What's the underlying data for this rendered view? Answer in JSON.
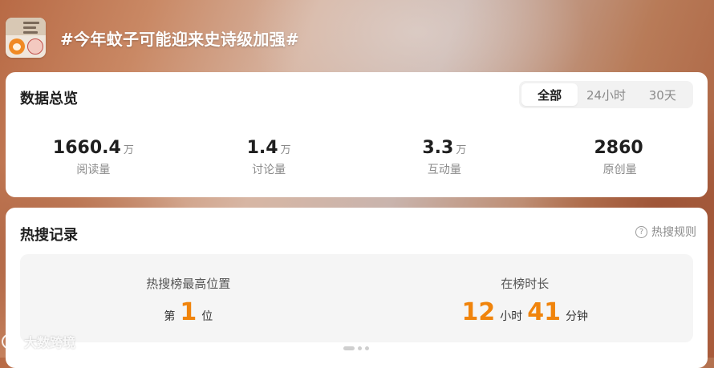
{
  "topic": {
    "title": "#今年蚊子可能迎来史诗级加强#",
    "thumbnail_icon": "topic-thumbnail-image"
  },
  "overview": {
    "title": "数据总览",
    "tabs": [
      {
        "label": "全部",
        "active": true
      },
      {
        "label": "24小时",
        "active": false
      },
      {
        "label": "30天",
        "active": false
      }
    ],
    "stats": [
      {
        "value": "1660.4",
        "unit": "万",
        "label": "阅读量"
      },
      {
        "value": "1.4",
        "unit": "万",
        "label": "讨论量"
      },
      {
        "value": "3.3",
        "unit": "万",
        "label": "互动量"
      },
      {
        "value": "2860",
        "unit": "",
        "label": "原创量"
      }
    ]
  },
  "hot_search": {
    "title": "热搜记录",
    "rules_label": "热搜规则",
    "rules_icon": "question-circle-icon",
    "peak": {
      "label": "热搜榜最高位置",
      "prefix": "第",
      "value": "1",
      "suffix": "位"
    },
    "duration": {
      "label": "在榜时长",
      "hours": "12",
      "hours_unit": "小时",
      "minutes": "41",
      "minutes_unit": "分钟"
    }
  },
  "watermark": {
    "text": "大数跨境",
    "icon": "brand-logo-icon"
  },
  "colors": {
    "accent": "#f0840c",
    "text_primary": "#1f1f1f",
    "text_secondary": "#8a8a8a"
  }
}
